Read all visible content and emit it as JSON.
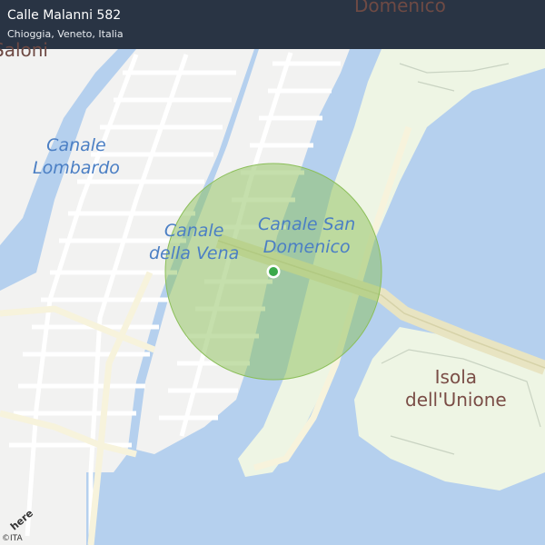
{
  "header": {
    "title": "Calle Malanni 582",
    "subtitle": "Chioggia, Veneto, Italia"
  },
  "map": {
    "labels": {
      "domenico_top": "Domenico",
      "saloni_top": "Saloni",
      "canale_lombardo": [
        "Canale",
        "Lombardo"
      ],
      "canale_vena": [
        "Canale",
        "della Vena"
      ],
      "canale_san_domenico": [
        "Canale San",
        "Domenico"
      ],
      "isola_unione": [
        "Isola",
        "dell'Unione"
      ]
    },
    "location_marker": {
      "status_color": "#3aa94a",
      "accuracy_color": "#8cbf5a"
    },
    "colors": {
      "water": "#b5d0ee",
      "land": "#f2f2f1",
      "park": "#eef5e4",
      "road": "#ffffff",
      "bridge": "#e8e4c2"
    }
  },
  "footer": {
    "logo": "here",
    "copyright": "©ITA"
  }
}
